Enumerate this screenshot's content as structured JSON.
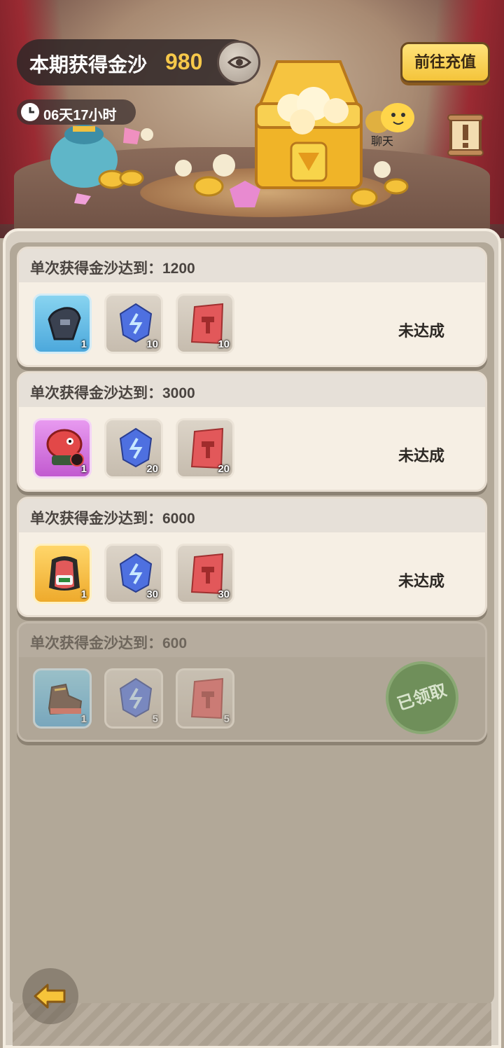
{
  "header": {
    "gold_label": "本期获得金沙",
    "gold_value": "980",
    "timer": "06天17小时",
    "recharge_label": "前往充值",
    "chat_label": "聊天"
  },
  "icons": {
    "eye": "eye-icon",
    "clock": "clock-icon",
    "back": "back-arrow-icon",
    "notice": "notice-scroll-icon",
    "chat": "chat-bubble-icon"
  },
  "colors": {
    "accent_gold": "#f6c84a",
    "claimed_stamp": "#6f8f5a"
  },
  "tiers": [
    {
      "title": "单次获得金沙达到：1200",
      "status": "未达成",
      "items": [
        {
          "name": "glove-item",
          "count": "1",
          "frame": "blue"
        },
        {
          "name": "blue-crystal-item",
          "count": "10",
          "frame": "gray"
        },
        {
          "name": "red-ticket-item",
          "count": "10",
          "frame": "gray"
        }
      ]
    },
    {
      "title": "单次获得金沙达到：3000",
      "status": "未达成",
      "items": [
        {
          "name": "monster-hat-item",
          "count": "1",
          "frame": "purple"
        },
        {
          "name": "blue-crystal-item",
          "count": "20",
          "frame": "gray"
        },
        {
          "name": "red-ticket-item",
          "count": "20",
          "frame": "gray"
        }
      ]
    },
    {
      "title": "单次获得金沙达到：6000",
      "status": "未达成",
      "items": [
        {
          "name": "outfit-item",
          "count": "1",
          "frame": "gold"
        },
        {
          "name": "blue-crystal-item",
          "count": "30",
          "frame": "gray"
        },
        {
          "name": "red-ticket-item",
          "count": "30",
          "frame": "gray"
        }
      ]
    },
    {
      "title": "单次获得金沙达到：600",
      "status": "已领取",
      "items": [
        {
          "name": "shoe-item",
          "count": "1",
          "frame": "blue"
        },
        {
          "name": "blue-crystal-item",
          "count": "5",
          "frame": "gray"
        },
        {
          "name": "red-ticket-item",
          "count": "5",
          "frame": "gray"
        }
      ]
    }
  ]
}
